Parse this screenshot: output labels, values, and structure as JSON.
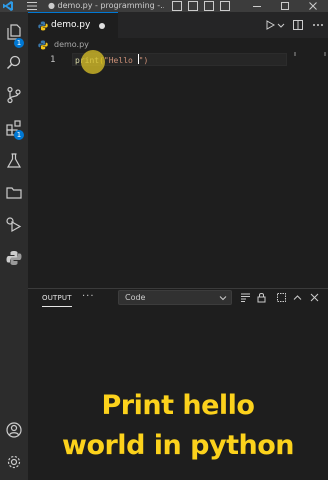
{
  "titlebar": {
    "title": "● demo.py - programming -..."
  },
  "activity": {
    "explorer_badge": "1",
    "extensions_badge": "1"
  },
  "tab": {
    "label": "demo.py",
    "icon": "python-icon",
    "unsaved_dot": true
  },
  "breadcrumb": {
    "file": "demo.py"
  },
  "editor": {
    "line_number": "1",
    "code_fn": "print",
    "code_open_paren": "(",
    "code_string": "\"Hello ",
    "code_close_rest": "\")"
  },
  "panel": {
    "tab_label": "OUTPUT",
    "more_label": "···",
    "channel_value": "Code"
  },
  "caption": {
    "line1": "Print hello",
    "line2": "world in python"
  },
  "colors": {
    "accent": "#0078d4",
    "caption": "#fcd21c",
    "pointer": "#d6be28",
    "function": "#dcdcaa",
    "string": "#ce9178"
  }
}
